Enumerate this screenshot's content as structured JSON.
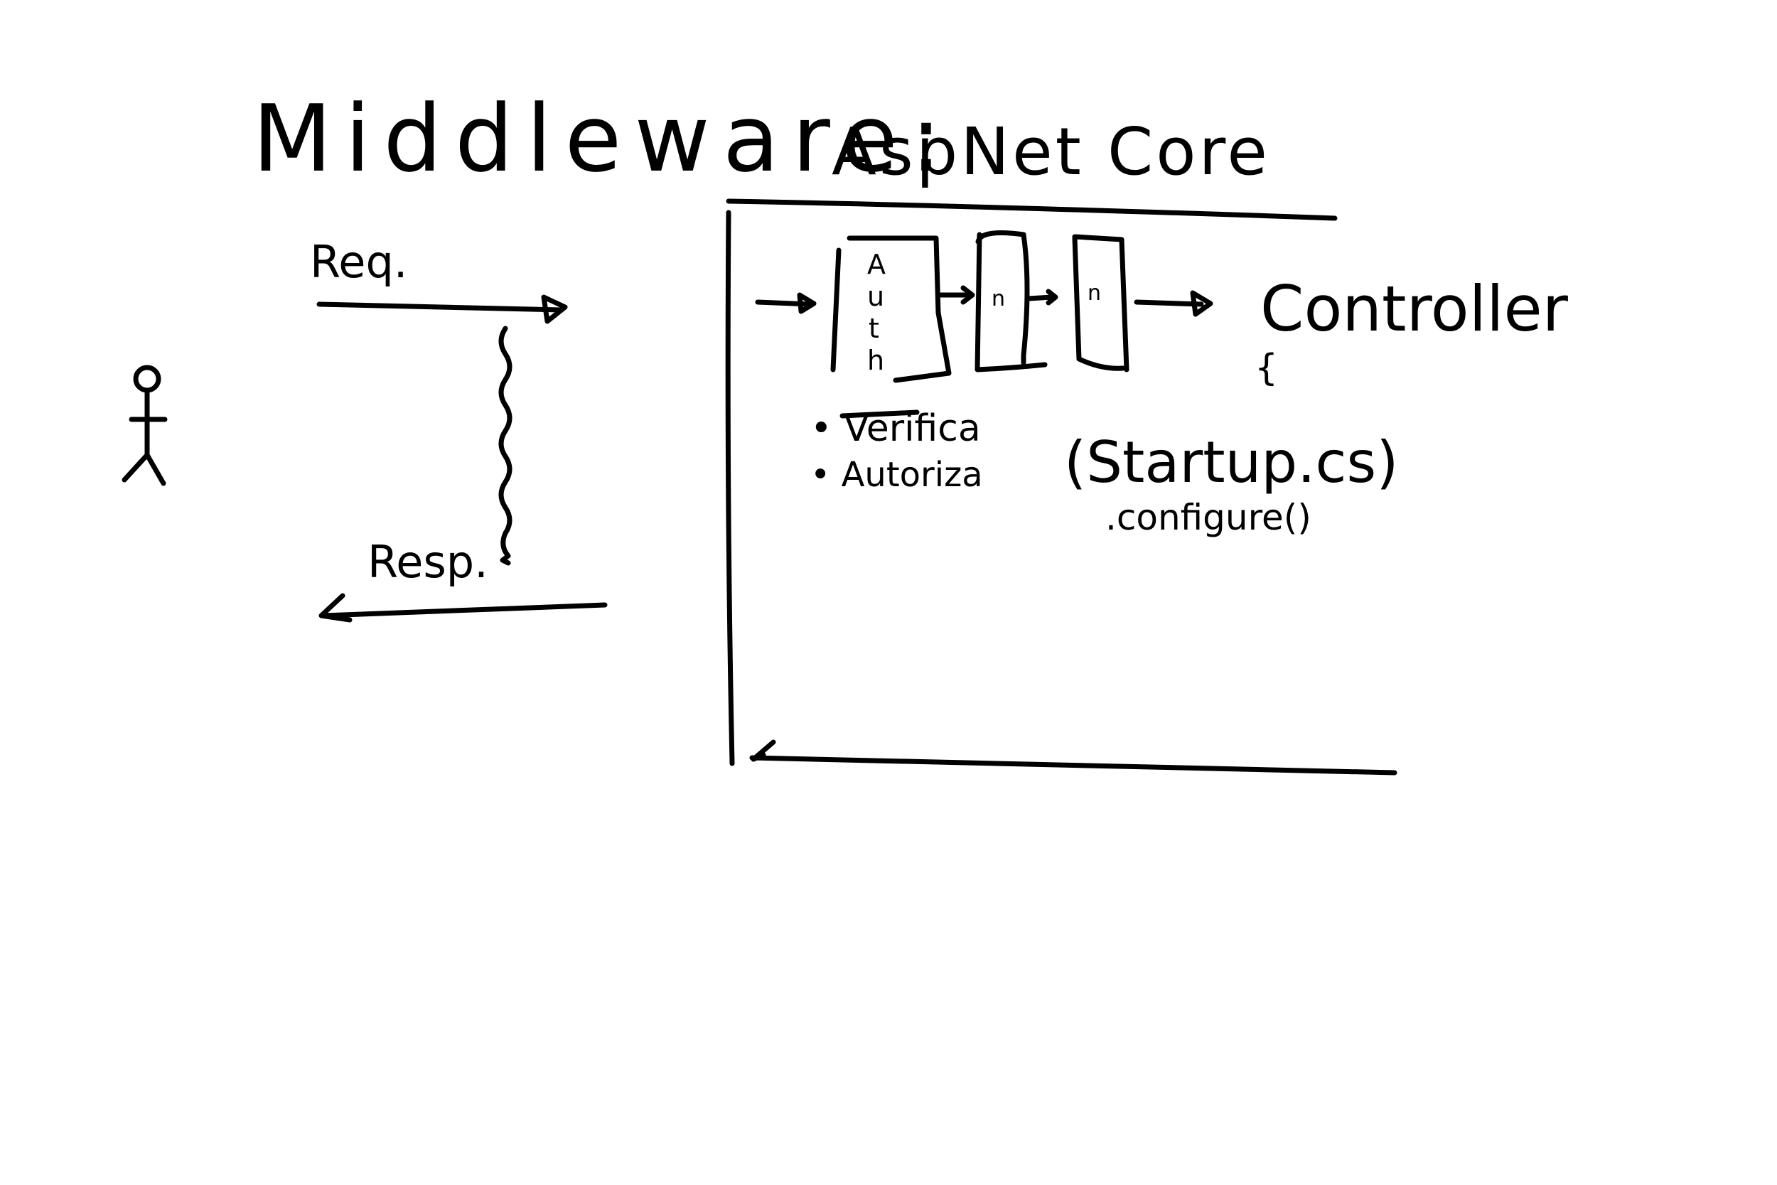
{
  "title": "Middleware:",
  "framework": "AspNet Core",
  "request_label": "Req.",
  "response_label": "Resp.",
  "pipeline": {
    "auth_letters": [
      "A",
      "u",
      "t",
      "h"
    ],
    "middleware_2": "n",
    "middleware_3": "n",
    "destination": "Controller",
    "brace": "{"
  },
  "notes": {
    "bullets": [
      "• Verifica",
      "• Autoriza"
    ],
    "startup": "(Startup.cs)",
    "configure": ".configure()"
  },
  "colors": {
    "ink": "#000000",
    "background": "#ffffff"
  }
}
